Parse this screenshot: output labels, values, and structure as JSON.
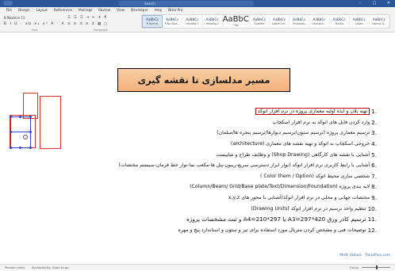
{
  "titlebar": {
    "search_placeholder": "Search"
  },
  "menu": {
    "items": [
      "File",
      "Design",
      "Layout",
      "References",
      "Mailings",
      "Review",
      "View",
      "Developer",
      "Help",
      "Nitro Pro"
    ]
  },
  "ribbon": {
    "font_name": "B Nazanin",
    "font_size": "11",
    "font_row2": "B I U · ab x₂ x² A · A",
    "para_row1": "☰ ☰ ☰ ⇥ ⇤ ↕ ¶",
    "para_row2": "≡ ≡ ≡ ≡ ↕ ▦ ▢",
    "group_font": "Font",
    "group_paragraph": "Paragraph",
    "styles": [
      {
        "sample": "AaBbCc",
        "name": "¶ Normal",
        "selected": true
      },
      {
        "sample": "AaBbCc",
        "name": "¶ No Spac...",
        "selected": false
      },
      {
        "sample": "AaBbCc",
        "name": "Heading 1",
        "selected": false
      },
      {
        "sample": "AaBbCc",
        "name": "Heading 2",
        "selected": false
      },
      {
        "sample": "AaBbCc",
        "name": "Title",
        "selected": false,
        "big": true,
        "big_sample": "AaBbC"
      },
      {
        "sample": "AaBbCc",
        "name": "Subtitle",
        "selected": false
      },
      {
        "sample": "AaBbCc",
        "name": "Subtle Em...",
        "selected": false
      },
      {
        "sample": "AaBbCc",
        "name": "Emphasis",
        "selected": false
      },
      {
        "sample": "AaBbCc",
        "name": "Intense E...",
        "selected": false
      },
      {
        "sample": "AaBbCc",
        "name": "Strong",
        "selected": false
      },
      {
        "sample": "AaBbCc",
        "name": "Quote",
        "selected": false
      },
      {
        "sample": "AaBbCc",
        "name": "Intense Q...",
        "selected": false
      }
    ]
  },
  "document": {
    "banner_title": "مسیر مدلسازی تا نقشه گیری",
    "items": [
      {
        "num": "1.",
        "text": "تهیه پلان و ایده اولیه معماری پروژه در نرم افزار اتوکد",
        "boxed": true
      },
      {
        "num": "2.",
        "text": "وارد کردن فایل های اتوکد به نرم افزار اسکچاپ"
      },
      {
        "num": "3.",
        "text": "ترسیم معماری پروژه (ترسیم ستون/ترسیم دیوارها/ترسیم پنجره ها/مبلمان)"
      },
      {
        "num": "4.",
        "text": "خروجی اسکچاپ به اتوکد و تهیه نقشه های معماری (architecture)"
      },
      {
        "num": "5.",
        "text": "آشنایی با نقشه های کارگاهی (Shop Drawing) و وظایف طراح و شاپیست"
      },
      {
        "num": "6.",
        "text": "آشنایی با رابط کاربری نرم افزار اتوکد (نوار ابزار دسترسی سریع-ریبون-پنل ها-مکعب نما-نوار خط فرمان-سیستم مختصات)"
      },
      {
        "num": "7.",
        "text": "شخصی سازی محیط اتوکد (Color them / Option )"
      },
      {
        "num": "8.",
        "text": "لایه بندی پروژه (Column/Beam/ Grid/Base plate/Text/Dimension/Foundation)"
      },
      {
        "num": "9.",
        "text": "مختصات جهانی و محلی در نرم افزار اتوکد/آشنایی با محور های x,y,z"
      },
      {
        "num": "10.",
        "text": "تنظیم واحد ترسیم در نرم افزار اتوکد (Drawing Units)"
      },
      {
        "num": "11.",
        "text": "ترسیم کادر ورق A3=297*420 یا A4=210*297 و ثبت مشخصات پروژه",
        "big": true
      },
      {
        "num": "12.",
        "text": "توضیحات فنی و مشخص کردن متریال مورد استفاده برای تیر و ستون و استاندارد پیچ و مهره"
      }
    ]
  },
  "watermark": "MrAli Abbasi · TeklaPlus.com",
  "status": {
    "page": "Persian (Iran)",
    "accessibility": "Accessibility: Good to go",
    "focus": "Focus"
  },
  "colors": {
    "titlebar": "#2b579a",
    "banner": "#f3b07a",
    "highlight_border": "#c00000",
    "shape_border": "#e03030",
    "selection_dot": "#2f3fd6"
  }
}
